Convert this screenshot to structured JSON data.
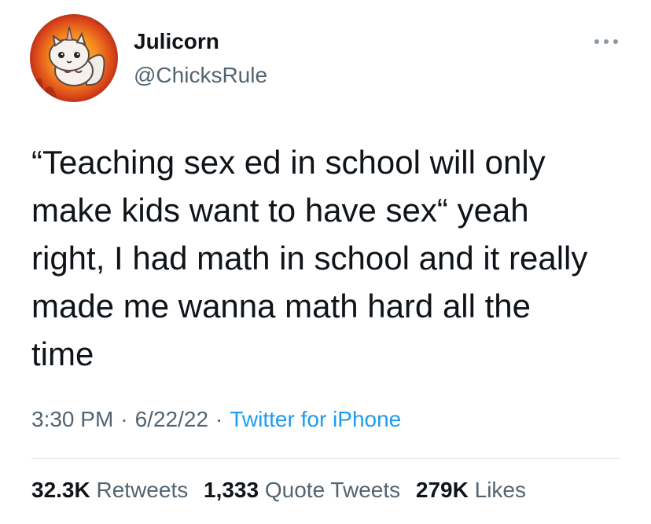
{
  "user": {
    "display_name": "Julicorn",
    "handle": "@ChicksRule"
  },
  "tweet": {
    "text": "“Teaching sex ed in school will only\nmake kids want to have sex“ yeah\nright, I had math in school and it really\nmade me wanna math hard all the\ntime"
  },
  "meta": {
    "time": "3:30 PM",
    "separator": "·",
    "date": "6/22/22",
    "source": "Twitter for iPhone"
  },
  "stats": {
    "retweets_count": "32.3K",
    "retweets_label": "Retweets",
    "quotes_count": "1,333",
    "quotes_label": "Quote Tweets",
    "likes_count": "279K",
    "likes_label": "Likes"
  },
  "icons": {
    "more": "more-horizontal-icon"
  },
  "colors": {
    "text_primary": "#0f1419",
    "text_secondary": "#536471",
    "link": "#1d9bf0",
    "divider": "#e5e8eb"
  }
}
